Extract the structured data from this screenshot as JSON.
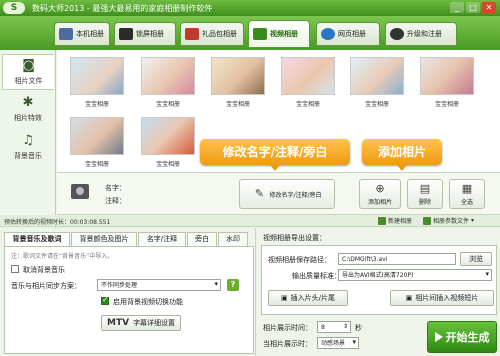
{
  "app": {
    "logo_text": "S",
    "title": "数码大师2013  -  最强大最易用的家庭相册制作软件",
    "window_buttons": {
      "minimize": "_",
      "maximize": "□",
      "close": "✕"
    }
  },
  "main_tabs": [
    {
      "label": "本机相册",
      "icon": "computer-icon"
    },
    {
      "label": "锁屏相册",
      "icon": "monitor-icon"
    },
    {
      "label": "礼品包相册",
      "icon": "gift-icon"
    },
    {
      "label": "视频相册",
      "icon": "film-icon",
      "active": true
    },
    {
      "label": "网页相册",
      "icon": "ie-icon"
    },
    {
      "label": "升级和注册",
      "icon": "upgrade-icon"
    }
  ],
  "sidebar": {
    "items": [
      {
        "label": "相片文件",
        "icon": "camera-icon",
        "glyph": "◙"
      },
      {
        "label": "相片特效",
        "icon": "effects-icon",
        "glyph": "✱"
      },
      {
        "label": "背景音乐",
        "icon": "music-icon",
        "glyph": "♫"
      }
    ]
  },
  "gallery": {
    "photos": [
      {
        "label": "宝宝相册"
      },
      {
        "label": "宝宝相册"
      },
      {
        "label": "宝宝相册"
      },
      {
        "label": "宝宝相册"
      },
      {
        "label": "宝宝相册"
      },
      {
        "label": "宝宝相册"
      },
      {
        "label": "宝宝相册"
      },
      {
        "label": "宝宝相册"
      }
    ]
  },
  "photo_info": {
    "name_label": "名字：",
    "note_label": "注释：",
    "rename_button": "修改名字/注释/旁白",
    "add_button": "添加相片",
    "delete_button": "删除",
    "select_all_button": "全选"
  },
  "callouts": {
    "rename": "修改名字/注释/旁白",
    "add": "添加相片"
  },
  "status": {
    "estimate_text": "预估转换后的视频时长：00:03:08.551",
    "new_album": "新建相册",
    "album_params": "相册参数文件"
  },
  "settings_tabs": [
    {
      "label": "背景音乐及歌词",
      "active": true
    },
    {
      "label": "背景颜色及图片"
    },
    {
      "label": "名字/注释"
    },
    {
      "label": "旁白"
    },
    {
      "label": "水印"
    }
  ],
  "music_settings": {
    "note": "注：歌词文件请在“背景音乐”中导入。",
    "cancel_music_label": "取消背景音乐",
    "sync_label": "音乐与相片同步方案：",
    "sync_value": "不作同步处理",
    "help_label": "?",
    "auto_switch_label": "启用背景视频切换功能",
    "mtv_label": "MTV",
    "mtv_button": "字幕详细设置"
  },
  "export_settings": {
    "title": "视频相册导出设置：",
    "path_label": "视频相册保存路径：",
    "path_value": "C:\\DMGift\\3.avi",
    "browse_button": "浏览",
    "quality_label": "输出质量标准：",
    "quality_value": "导出为AVI格式(高清720P)",
    "insert_button": "插入片头/片尾",
    "photo_video_button": "相片间插入视频短片",
    "display_time_label": "相片展示时间：",
    "display_time_value": "8",
    "seconds_unit": "秒",
    "transition_label": "当相片展示时：",
    "transition_value": "动感场景",
    "generate_button": "开始生成"
  },
  "colors": {
    "brand_green": "#4a9a25",
    "callout_orange": "#f09a12",
    "generate_green": "#3f9a1a"
  }
}
